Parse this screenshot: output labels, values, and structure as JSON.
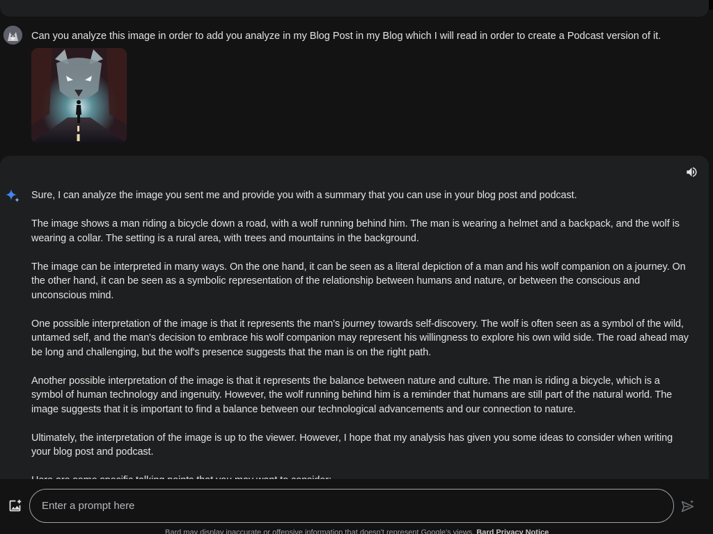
{
  "user_message": {
    "text": "Can you analyze this image in order to add you analyze in my Blog Post in my Blog which I will read in order to create a Podcast version of it."
  },
  "response": {
    "paragraphs": [
      "Sure, I can analyze the image you sent me and provide you with a summary that you can use in your blog post and podcast.",
      "The image shows a man riding a bicycle down a road, with a wolf running behind him. The man is wearing a helmet and a backpack, and the wolf is wearing a collar. The setting is a rural area, with trees and mountains in the background.",
      "The image can be interpreted in many ways. On the one hand, it can be seen as a literal depiction of a man and his wolf companion on a journey. On the other hand, it can be seen as a symbolic representation of the relationship between humans and nature, or between the conscious and unconscious mind.",
      "One possible interpretation of the image is that it represents the man's journey towards self-discovery. The wolf is often seen as a symbol of the wild, untamed self, and the man's decision to embrace his wolf companion may represent his willingness to explore his own wild side. The road ahead may be long and challenging, but the wolf's presence suggests that the man is on the right path.",
      "Another possible interpretation of the image is that it represents the balance between nature and culture. The man is riding a bicycle, which is a symbol of human technology and ingenuity. However, the wolf running behind him is a reminder that humans are still part of the natural world. The image suggests that it is important to find a balance between our technological advancements and our connection to nature.",
      "Ultimately, the interpretation of the image is up to the viewer. However, I hope that my analysis has given you some ideas to consider when writing your blog post and podcast.",
      "Here are some specific talking points that you may want to consider:"
    ]
  },
  "input": {
    "placeholder": "Enter a prompt here"
  },
  "footer": {
    "text": "Bard may display inaccurate or offensive information that doesn't represent Google's views.",
    "link": "Bard Privacy Notice"
  },
  "icons": {
    "speaker": "volume-up-icon",
    "sparkle": "bard-sparkle-icon",
    "image_upload": "add-photo-icon",
    "send": "send-icon"
  },
  "colors": {
    "background": "#131314",
    "surface": "#1e1f20",
    "text": "#e3e3e3",
    "sparkle_blue": "#4285f4",
    "input_border": "#a0a3a8"
  }
}
